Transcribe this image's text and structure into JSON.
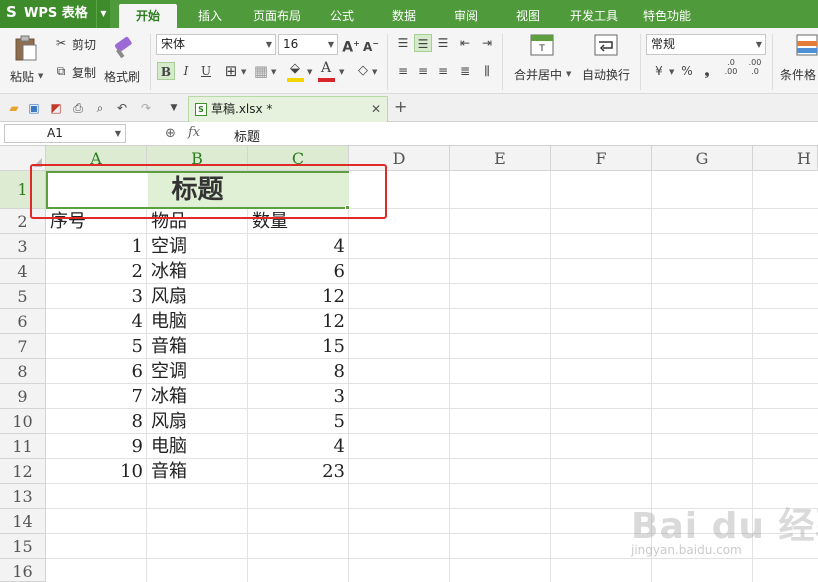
{
  "app": {
    "brand": "WPS 表格",
    "menu_tabs": [
      "开始",
      "插入",
      "页面布局",
      "公式",
      "数据",
      "审阅",
      "视图",
      "开发工具",
      "特色功能"
    ],
    "active_tab": "开始",
    "accent_color": "#4f9a3a"
  },
  "ribbon": {
    "paste": "粘贴",
    "cut": "剪切",
    "copy": "复制",
    "format_painter": "格式刷",
    "font_name": "宋体",
    "font_size": "16",
    "bold": "B",
    "italic": "I",
    "underline": "U",
    "merge_center": "合并居中",
    "wrap_text": "自动换行",
    "number_format": "常规",
    "percent": "%",
    "thousands": "❟",
    "increase_decimal": ".0\n.00",
    "decrease_decimal": ".00\n.0",
    "conditional_format": "条件格",
    "font_color": "#d9262c",
    "fill_color": "#f5d400"
  },
  "document": {
    "tab_title": "草稿.xlsx *"
  },
  "formula_bar": {
    "cell_ref": "A1",
    "value": "标题"
  },
  "sheet": {
    "columns": [
      "A",
      "B",
      "C",
      "D",
      "E",
      "F",
      "G",
      "H"
    ],
    "rows": [
      "1",
      "2",
      "3",
      "4",
      "5",
      "6",
      "7",
      "8",
      "9",
      "10",
      "11",
      "12",
      "13",
      "14",
      "15",
      "16"
    ],
    "title": "标题",
    "headers": [
      "序号",
      "物品",
      "数量"
    ],
    "data": [
      {
        "no": "1",
        "item": "空调",
        "qty": "4"
      },
      {
        "no": "2",
        "item": "冰箱",
        "qty": "6"
      },
      {
        "no": "3",
        "item": "风扇",
        "qty": "12"
      },
      {
        "no": "4",
        "item": "电脑",
        "qty": "12"
      },
      {
        "no": "5",
        "item": "音箱",
        "qty": "15"
      },
      {
        "no": "6",
        "item": "空调",
        "qty": "8"
      },
      {
        "no": "7",
        "item": "冰箱",
        "qty": "3"
      },
      {
        "no": "8",
        "item": "风扇",
        "qty": "5"
      },
      {
        "no": "9",
        "item": "电脑",
        "qty": "4"
      },
      {
        "no": "10",
        "item": "音箱",
        "qty": "23"
      }
    ]
  },
  "watermark": {
    "logo": "Bai du 经验",
    "url": "jingyan.baidu.com"
  }
}
